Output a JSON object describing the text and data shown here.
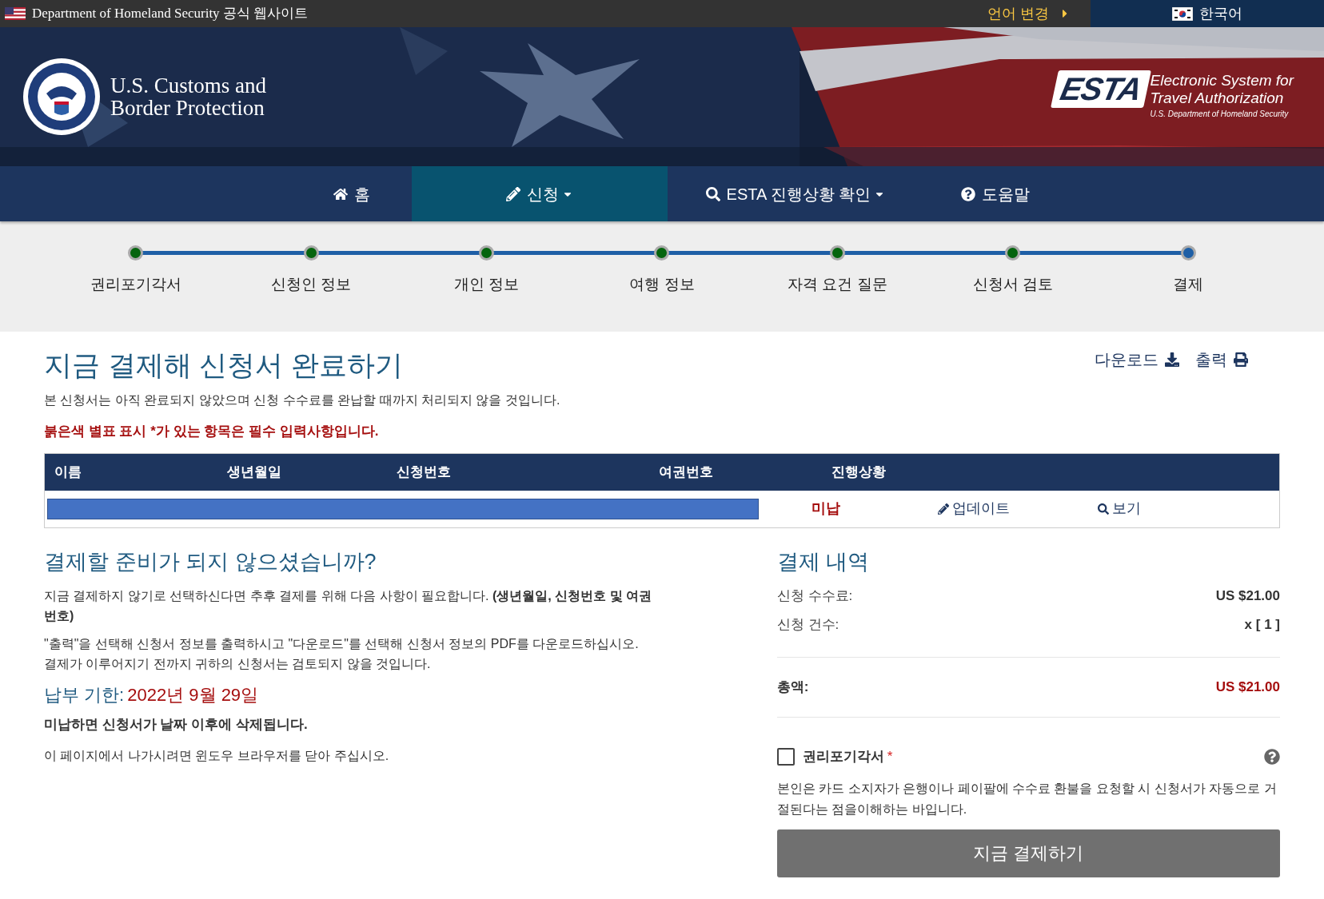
{
  "top_bar": {
    "site_label": "Department of Homeland Security 공식 웹사이트",
    "language_change": "언어 변경",
    "language": "한국어"
  },
  "header": {
    "agency_name": "U.S. Customs and Border Protection",
    "esta_logo": {
      "acronym": "ESTA",
      "line_1": "Electronic System for",
      "line_2": "Travel Authorization",
      "department": "U.S. Department of Homeland Security"
    }
  },
  "nav": [
    {
      "kind": "home",
      "label": "홈",
      "selected": false,
      "dropdown": false
    },
    {
      "kind": "edit",
      "label": "신청",
      "selected": true,
      "dropdown": true
    },
    {
      "kind": "search",
      "label": "ESTA 진행상황 확인",
      "selected": false,
      "dropdown": true
    },
    {
      "kind": "help",
      "label": "도움말",
      "selected": false,
      "dropdown": false
    }
  ],
  "steps": [
    {
      "label": "권리포기각서",
      "done": true
    },
    {
      "label": "신청인 정보",
      "done": true
    },
    {
      "label": "개인 정보",
      "done": true
    },
    {
      "label": "여행 정보",
      "done": true
    },
    {
      "label": "자격 요건 질문",
      "done": true
    },
    {
      "label": "신청서 검토",
      "done": true
    },
    {
      "label": "결제",
      "done": false
    }
  ],
  "page": {
    "title": "지금 결제해 신청서 완료하기",
    "download": "다운로드",
    "print": "출력",
    "notice": "본 신청서는 아직 완료되지 않았으며 신청 수수료를 완납할 때까지 처리되지 않을 것입니다.",
    "required_note": "붉은색 별표 표시 *가 있는 항목은 필수 입력사항입니다."
  },
  "table": {
    "columns": [
      "이름",
      "생년월일",
      "신청번호",
      "여권번호",
      "진행상황"
    ],
    "rows": [
      {
        "redacted": true,
        "status": "미납",
        "update": "업데이트",
        "view": "보기"
      }
    ]
  },
  "not_ready": {
    "title": "결제할 준비가 되지 않으셨습니까?",
    "paragraph_1": "지금 결제하지 않기로 선택하신다면 추후 결제를 위해 다음 사항이 필요합니다. **(생년월일, 신청번호 및 여권번호)**",
    "paragraph_2": "\"출력\"을 선택해 신청서 정보를 출력하시고 \"다운로드\"를 선택해 신청서 정보의 PDF를 다운로드하십시오. 결제가 이루어지기 전까지 귀하의 신청서는 검토되지 않을 것입니다.",
    "due_label": "납부 기한:",
    "due_date": "2022년 9월 29일",
    "warning": "미납하면 신청서가 날짜 이후에 삭제됩니다.",
    "exit_note": "이 페이지에서 나가시려면 윈도우 브라우저를 닫아 주십시오."
  },
  "payment": {
    "title": "결제 내역",
    "lines": [
      {
        "label": "신청 수수료:",
        "value": "US $21.00"
      },
      {
        "label": "신청 건수:",
        "value": "x [ 1 ]"
      }
    ],
    "total_label": "총액:",
    "total_value": "US $21.00",
    "waiver": {
      "label": "권리포기각서",
      "required": "*",
      "checked": false
    },
    "waiver_text": "본인은 카드 소지자가 은행이나 페이팔에 수수료 환불을 요청할 시 신청서가 자동으로 거절된다는 점을이해하는 바입니다.",
    "pay_button": "지금 결제하기"
  }
}
